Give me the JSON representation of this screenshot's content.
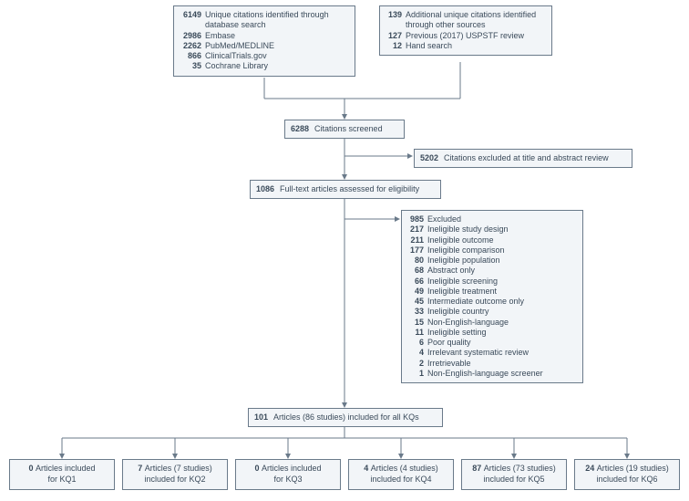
{
  "box_identified": {
    "count": "6149",
    "label": "Unique citations identified through database search",
    "items": [
      {
        "n": "2986",
        "l": "Embase"
      },
      {
        "n": "2262",
        "l": "PubMed/MEDLINE"
      },
      {
        "n": "866",
        "l": "ClinicalTrials.gov"
      },
      {
        "n": "35",
        "l": "Cochrane Library"
      }
    ]
  },
  "box_additional": {
    "count": "139",
    "label": "Additional unique citations identified through other sources",
    "items": [
      {
        "n": "127",
        "l": "Previous (2017) USPSTF review"
      },
      {
        "n": "12",
        "l": "Hand search"
      }
    ]
  },
  "box_screened": {
    "count": "6288",
    "label": "Citations screened"
  },
  "box_excluded1": {
    "count": "5202",
    "label": "Citations excluded at title and abstract review"
  },
  "box_fulltext": {
    "count": "1086",
    "label": "Full-text articles assessed for eligibility"
  },
  "box_excluded2": {
    "count": "985",
    "label": "Excluded",
    "items": [
      {
        "n": "217",
        "l": "Ineligible study design"
      },
      {
        "n": "211",
        "l": "Ineligible outcome"
      },
      {
        "n": "177",
        "l": "Ineligible comparison"
      },
      {
        "n": "80",
        "l": "Ineligible population"
      },
      {
        "n": "68",
        "l": "Abstract only"
      },
      {
        "n": "66",
        "l": "Ineligible screening"
      },
      {
        "n": "49",
        "l": "Ineligible treatment"
      },
      {
        "n": "45",
        "l": "Intermediate outcome only"
      },
      {
        "n": "33",
        "l": "Ineligible country"
      },
      {
        "n": "15",
        "l": "Non-English-language"
      },
      {
        "n": "11",
        "l": "Ineligible setting"
      },
      {
        "n": "6",
        "l": "Poor quality"
      },
      {
        "n": "4",
        "l": "Irrelevant systematic review"
      },
      {
        "n": "2",
        "l": "Irretrievable"
      },
      {
        "n": "1",
        "l": "Non-English-language screener"
      }
    ]
  },
  "box_included": {
    "count": "101",
    "label": "Articles (86 studies) included for all KQs"
  },
  "kqs": [
    {
      "n": "0",
      "l1": "Articles included",
      "l2": "for KQ1"
    },
    {
      "n": "7",
      "l1": "Articles (7 studies)",
      "l2": "included for KQ2"
    },
    {
      "n": "0",
      "l1": "Articles included",
      "l2": "for KQ3"
    },
    {
      "n": "4",
      "l1": "Articles (4 studies)",
      "l2": "included for KQ4"
    },
    {
      "n": "87",
      "l1": "Articles (73 studies)",
      "l2": "included for KQ5"
    },
    {
      "n": "24",
      "l1": "Articles (19 studies)",
      "l2": "included for KQ6"
    }
  ]
}
